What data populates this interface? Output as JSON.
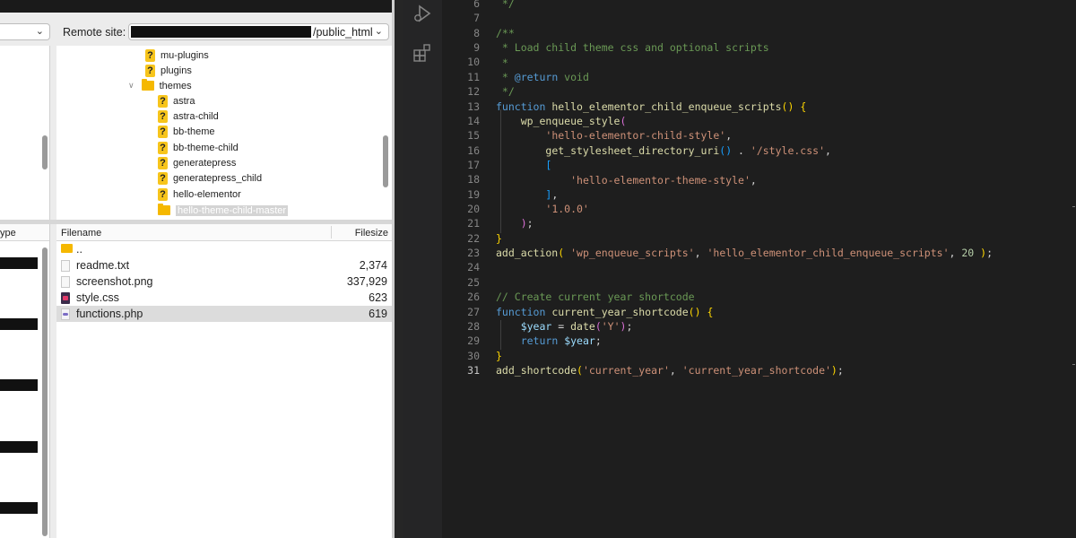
{
  "ftp": {
    "remote_label": "Remote site:",
    "remote_path_suffix": "/public_html",
    "local_type_header": "ype",
    "tree": [
      {
        "label": "mu-plugins",
        "icon": "question-folder-icon"
      },
      {
        "label": "plugins",
        "icon": "question-folder-icon"
      },
      {
        "label": "themes",
        "icon": "folder-icon",
        "expanded": true
      },
      {
        "label": "astra",
        "icon": "question-folder-icon"
      },
      {
        "label": "astra-child",
        "icon": "question-folder-icon"
      },
      {
        "label": "bb-theme",
        "icon": "question-folder-icon"
      },
      {
        "label": "bb-theme-child",
        "icon": "question-folder-icon"
      },
      {
        "label": "generatepress",
        "icon": "question-folder-icon"
      },
      {
        "label": "generatepress_child",
        "icon": "question-folder-icon"
      },
      {
        "label": "hello-elementor",
        "icon": "question-folder-icon"
      },
      {
        "label": "hello-theme-child-master",
        "icon": "folder-icon",
        "selected": true
      }
    ],
    "list_headers": {
      "filename": "Filename",
      "filesize": "Filesize"
    },
    "files": [
      {
        "name": "..",
        "size": "",
        "icon": "folder-up-icon"
      },
      {
        "name": "readme.txt",
        "size": "2,374",
        "icon": "text-file-icon"
      },
      {
        "name": "screenshot.png",
        "size": "337,929",
        "icon": "image-file-icon"
      },
      {
        "name": "style.css",
        "size": "623",
        "icon": "css-file-icon"
      },
      {
        "name": "functions.php",
        "size": "619",
        "icon": "php-file-icon",
        "selected": true
      }
    ]
  },
  "editor": {
    "current_line": "31",
    "lines": [
      {
        "n": "6"
      },
      {
        "n": "7"
      },
      {
        "n": "8"
      },
      {
        "n": "9"
      },
      {
        "n": "10"
      },
      {
        "n": "11"
      },
      {
        "n": "12"
      },
      {
        "n": "13"
      },
      {
        "n": "14"
      },
      {
        "n": "15"
      },
      {
        "n": "16"
      },
      {
        "n": "17"
      },
      {
        "n": "18"
      },
      {
        "n": "19"
      },
      {
        "n": "20"
      },
      {
        "n": "21"
      },
      {
        "n": "22"
      },
      {
        "n": "23"
      },
      {
        "n": "24"
      },
      {
        "n": "25"
      },
      {
        "n": "26"
      },
      {
        "n": "27"
      },
      {
        "n": "28"
      },
      {
        "n": "29"
      },
      {
        "n": "30"
      },
      {
        "n": "31"
      }
    ],
    "code": {
      "l6": " */",
      "l8": "/**",
      "l9": " * Load child theme css and optional scripts",
      "l10": " *",
      "l11_a": " * ",
      "l11_b": "@return",
      "l11_c": " void",
      "l12": " */",
      "l13_kw": "function",
      "l13_fn": "hello_elementor_child_enqueue_scripts",
      "l14_fn": "wp_enqueue_style",
      "l15_s": "'hello-elementor-child-style'",
      "l16_fn": "get_stylesheet_directory_uri",
      "l16_op": " . ",
      "l16_s": "'/style.css'",
      "l18_s": "'hello-elementor-theme-style'",
      "l20_s": "'1.0.0'",
      "l23_fn": "add_action",
      "l23_s1": "'wp_enqueue_scripts'",
      "l23_s2": "'hello_elementor_child_enqueue_scripts'",
      "l23_n": "20",
      "l26": "// Create current year shortcode",
      "l27_kw": "function",
      "l27_fn": "current_year_shortcode",
      "l28_v": "$year",
      "l28_fn": "date",
      "l28_s": "'Y'",
      "l29_kw": "return",
      "l29_v": "$year",
      "l31_fn": "add_shortcode",
      "l31_s1": "'current_year'",
      "l31_s2": "'current_year_shortcode'"
    }
  }
}
